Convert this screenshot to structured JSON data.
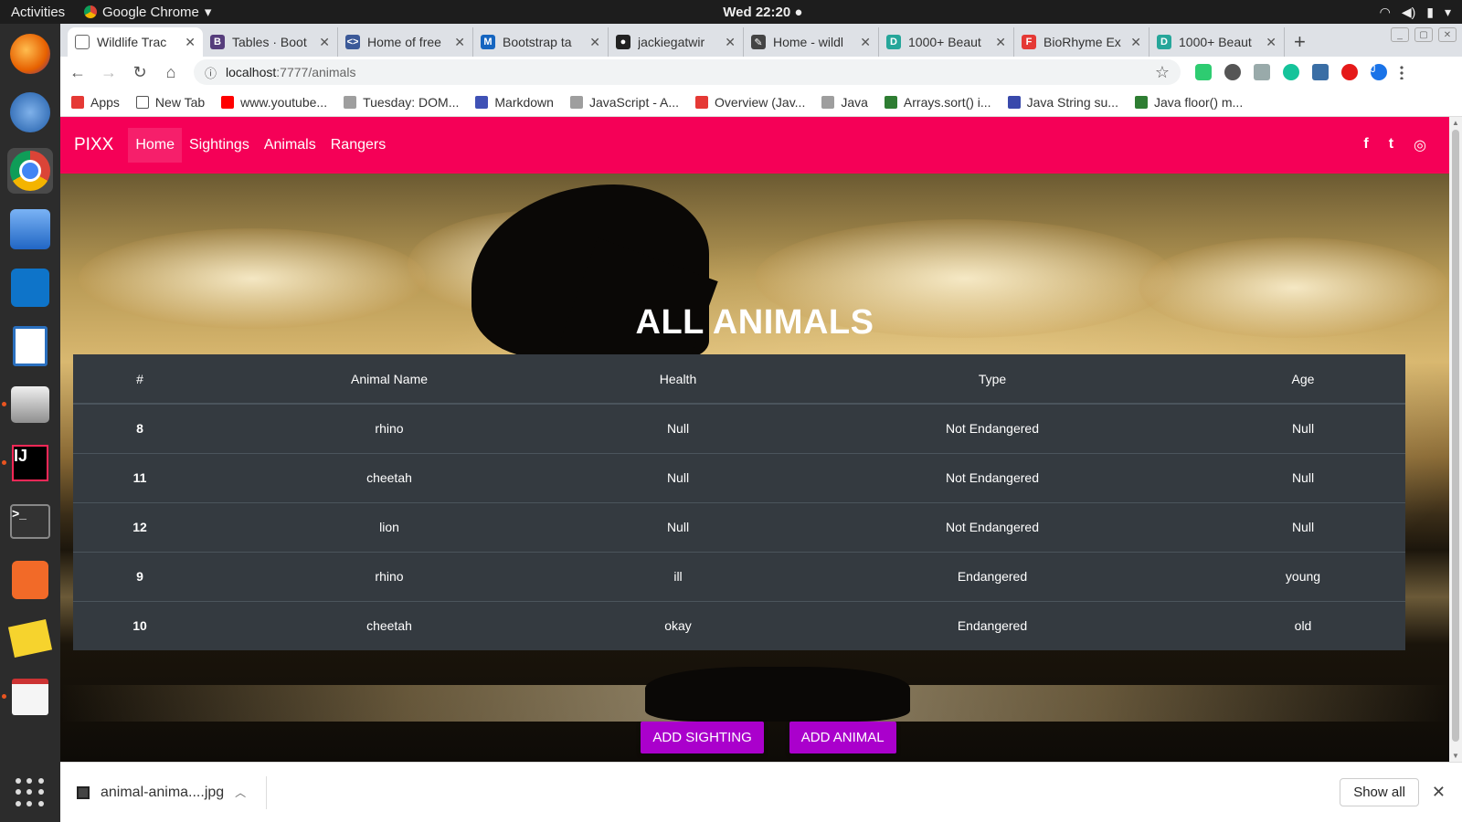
{
  "topbar": {
    "activities": "Activities",
    "app_name": "Google Chrome",
    "clock": "Wed 22:20"
  },
  "tabs": [
    {
      "title": "Wildlife Trac",
      "color": "#ffffff",
      "fav": ""
    },
    {
      "title": "Tables · Boot",
      "color": "#563d7c",
      "fav": "B"
    },
    {
      "title": "Home of free",
      "color": "#3b5998",
      "fav": "<>"
    },
    {
      "title": "Bootstrap ta",
      "color": "#1565c0",
      "fav": "M"
    },
    {
      "title": "jackiegatwir",
      "color": "#222222",
      "fav": "●"
    },
    {
      "title": "Home - wildl",
      "color": "#444444",
      "fav": "✎"
    },
    {
      "title": "1000+ Beaut",
      "color": "#26a69a",
      "fav": "D"
    },
    {
      "title": "BioRhyme Ex",
      "color": "#e53935",
      "fav": "F"
    },
    {
      "title": "1000+ Beaut",
      "color": "#26a69a",
      "fav": "D"
    }
  ],
  "toolbar": {
    "url_host": "localhost",
    "url_path": ":7777/animals",
    "profile_initial": "J"
  },
  "bookmarks": [
    {
      "label": "Apps",
      "color": "#e53935"
    },
    {
      "label": "New Tab",
      "color": "#ffffff"
    },
    {
      "label": "www.youtube...",
      "color": "#ff0000"
    },
    {
      "label": "Tuesday: DOM...",
      "color": "#9e9e9e"
    },
    {
      "label": "Markdown",
      "color": "#3f51b5"
    },
    {
      "label": "JavaScript - A...",
      "color": "#9e9e9e"
    },
    {
      "label": "Overview (Jav...",
      "color": "#e53935"
    },
    {
      "label": "Java",
      "color": "#9e9e9e"
    },
    {
      "label": "Arrays.sort() i...",
      "color": "#2e7d32"
    },
    {
      "label": "Java String su...",
      "color": "#3949ab"
    },
    {
      "label": "Java floor() m...",
      "color": "#2e7d32"
    }
  ],
  "site": {
    "brand": "PIXX",
    "nav": [
      "Home",
      "Sightings",
      "Animals",
      "Rangers"
    ],
    "active_nav": "Home",
    "socials": [
      "f",
      "t",
      "◎"
    ],
    "accent": "#f50057",
    "heading": "ALL ANIMALS",
    "table": {
      "headers": [
        "#",
        "Animal Name",
        "Health",
        "Type",
        "Age"
      ],
      "rows": [
        [
          "8",
          "rhino",
          "Null",
          "Not Endangered",
          "Null"
        ],
        [
          "11",
          "cheetah",
          "Null",
          "Not Endangered",
          "Null"
        ],
        [
          "12",
          "lion",
          "Null",
          "Not Endangered",
          "Null"
        ],
        [
          "9",
          "rhino",
          "ill",
          "Endangered",
          "young"
        ],
        [
          "10",
          "cheetah",
          "okay",
          "Endangered",
          "old"
        ]
      ]
    },
    "buttons": {
      "add_sighting": "ADD SIGHTING",
      "add_animal": "ADD ANIMAL",
      "color": "#aa00cc"
    }
  },
  "downloads": {
    "file": "animal-anima....jpg",
    "show_all": "Show all"
  }
}
